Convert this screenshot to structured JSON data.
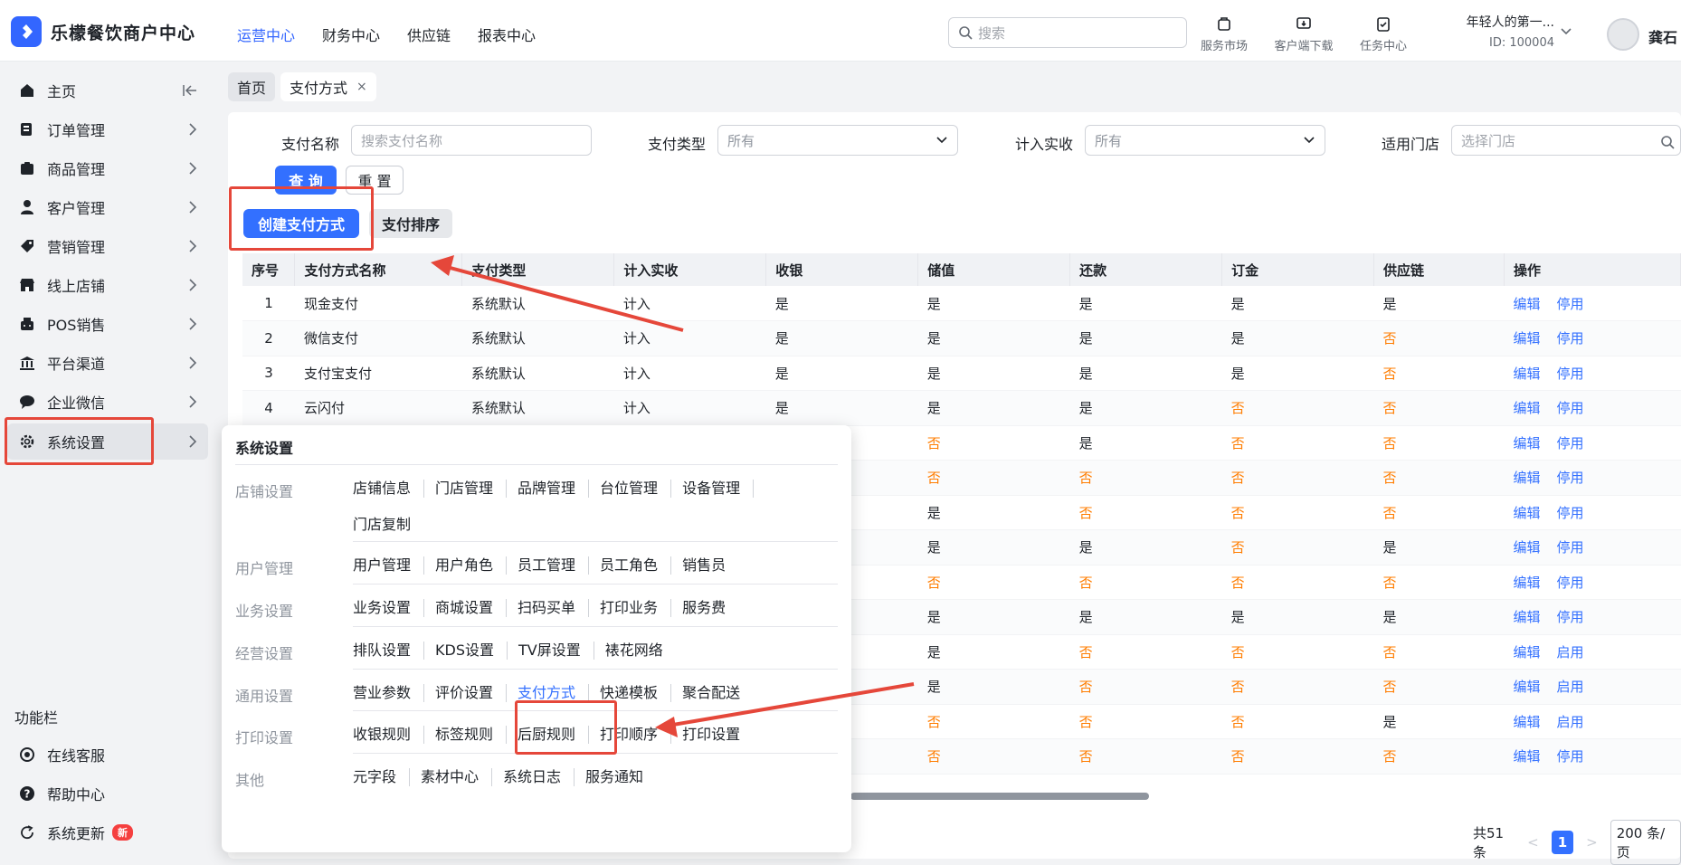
{
  "header": {
    "app_title": "乐檬餐饮商户中心",
    "nav": [
      "运营中心",
      "财务中心",
      "供应链",
      "报表中心"
    ],
    "search_placeholder": "搜索",
    "tools": [
      "服务市场",
      "客户端下载",
      "任务中心"
    ],
    "account_name": "年轻人的第一...",
    "account_id": "ID: 100004",
    "user": "龚石"
  },
  "sidebar": {
    "items": [
      "主页",
      "订单管理",
      "商品管理",
      "客户管理",
      "营销管理",
      "线上店铺",
      "POS销售",
      "平台渠道",
      "企业微信",
      "系统设置"
    ],
    "func_title": "功能栏",
    "func_items": [
      "在线客服",
      "帮助中心",
      "系统更新"
    ],
    "new_badge": "新"
  },
  "tabs": {
    "home": "首页",
    "current": "支付方式",
    "close": "×"
  },
  "filters": {
    "name_label": "支付名称",
    "name_placeholder": "搜索支付名称",
    "type_label": "支付类型",
    "type_value": "所有",
    "income_label": "计入实收",
    "income_value": "所有",
    "store_label": "适用门店",
    "store_placeholder": "选择门店",
    "query": "查 询",
    "reset": "重 置"
  },
  "actions": {
    "create": "创建支付方式",
    "sort": "支付排序"
  },
  "table": {
    "headers": [
      "序号",
      "支付方式名称",
      "支付类型",
      "计入实收",
      "收银",
      "储值",
      "还款",
      "订金",
      "供应链",
      "操作"
    ],
    "rows": [
      [
        "1",
        "现金支付",
        "系统默认",
        "计入",
        "是",
        "是",
        "是",
        "是",
        "是",
        "编辑",
        "停用"
      ],
      [
        "2",
        "微信支付",
        "系统默认",
        "计入",
        "是",
        "是",
        "是",
        "是",
        "否",
        "编辑",
        "停用"
      ],
      [
        "3",
        "支付宝支付",
        "系统默认",
        "计入",
        "是",
        "是",
        "是",
        "是",
        "否",
        "编辑",
        "停用"
      ],
      [
        "4",
        "云闪付",
        "系统默认",
        "计入",
        "是",
        "是",
        "是",
        "否",
        "否",
        "编辑",
        "停用"
      ],
      [
        "",
        "",
        "",
        "",
        "",
        "否",
        "是",
        "否",
        "否",
        "编辑",
        "停用"
      ],
      [
        "",
        "",
        "",
        "",
        "",
        "否",
        "否",
        "否",
        "否",
        "编辑",
        "停用"
      ],
      [
        "",
        "",
        "",
        "",
        "",
        "是",
        "否",
        "否",
        "否",
        "编辑",
        "停用"
      ],
      [
        "",
        "",
        "",
        "",
        "",
        "是",
        "是",
        "否",
        "是",
        "编辑",
        "停用"
      ],
      [
        "",
        "",
        "",
        "",
        "",
        "否",
        "否",
        "否",
        "否",
        "编辑",
        "停用"
      ],
      [
        "",
        "",
        "",
        "",
        "",
        "是",
        "是",
        "是",
        "是",
        "编辑",
        "停用"
      ],
      [
        "",
        "",
        "",
        "",
        "",
        "是",
        "否",
        "否",
        "否",
        "编辑",
        "启用"
      ],
      [
        "",
        "",
        "",
        "",
        "",
        "是",
        "否",
        "否",
        "否",
        "编辑",
        "启用"
      ],
      [
        "",
        "",
        "",
        "",
        "",
        "否",
        "否",
        "否",
        "是",
        "编辑",
        "启用"
      ],
      [
        "",
        "",
        "",
        "",
        "",
        "否",
        "否",
        "否",
        "否",
        "编辑",
        "停用"
      ]
    ]
  },
  "pager": {
    "total": "共51条",
    "page": "1",
    "size": "200 条/页"
  },
  "popup": {
    "title": "系统设置",
    "groups": [
      {
        "label": "店铺设置",
        "items": [
          "店铺信息",
          "门店管理",
          "品牌管理",
          "台位管理",
          "设备管理",
          "门店复制"
        ]
      },
      {
        "label": "用户管理",
        "items": [
          "用户管理",
          "用户角色",
          "员工管理",
          "员工角色",
          "销售员"
        ]
      },
      {
        "label": "业务设置",
        "items": [
          "业务设置",
          "商城设置",
          "扫码买单",
          "打印业务",
          "服务费"
        ]
      },
      {
        "label": "经营设置",
        "items": [
          "排队设置",
          "KDS设置",
          "TV屏设置",
          "裱花网络"
        ]
      },
      {
        "label": "通用设置",
        "items": [
          "营业参数",
          "评价设置",
          "支付方式",
          "快递模板",
          "聚合配送"
        ]
      },
      {
        "label": "打印设置",
        "items": [
          "收银规则",
          "标签规则",
          "后厨规则",
          "打印顺序",
          "打印设置"
        ]
      },
      {
        "label": "其他",
        "items": [
          "元字段",
          "素材中心",
          "系统日志",
          "服务通知"
        ]
      }
    ]
  },
  "colors": {
    "accent": "#3370ff",
    "no": "#ff7d00",
    "annotation": "#e5473a"
  }
}
